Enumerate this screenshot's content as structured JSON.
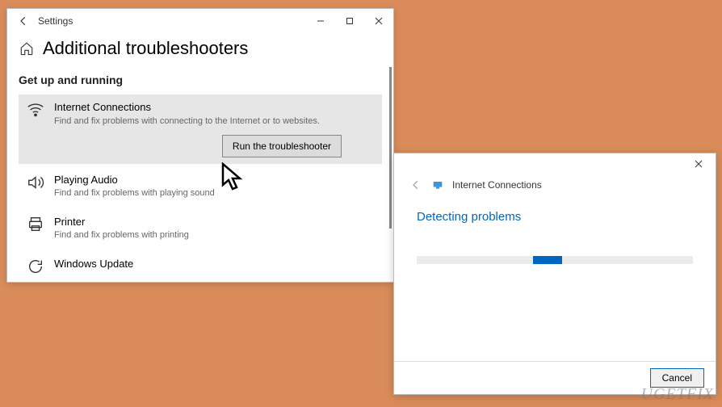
{
  "settings_window": {
    "back_nav_visible": true,
    "titlebar_label": "Settings",
    "page_title": "Additional troubleshooters",
    "section_title": "Get up and running",
    "run_button_label": "Run the troubleshooter",
    "items": [
      {
        "title": "Internet Connections",
        "desc": "Find and fix problems with connecting to the Internet or to websites.",
        "icon": "network-icon",
        "active": true
      },
      {
        "title": "Playing Audio",
        "desc": "Find and fix problems with playing sound",
        "icon": "sound-icon",
        "active": false
      },
      {
        "title": "Printer",
        "desc": "Find and fix problems with printing",
        "icon": "printer-icon",
        "active": false
      },
      {
        "title": "Windows Update",
        "desc": "",
        "icon": "update-icon",
        "active": false
      }
    ]
  },
  "troubleshooter_dialog": {
    "app_title": "Internet Connections",
    "status_text": "Detecting problems",
    "cancel_label": "Cancel"
  },
  "watermark": "UGETFIX",
  "colors": {
    "background": "#d98c5a",
    "accent": "#0067c0"
  }
}
